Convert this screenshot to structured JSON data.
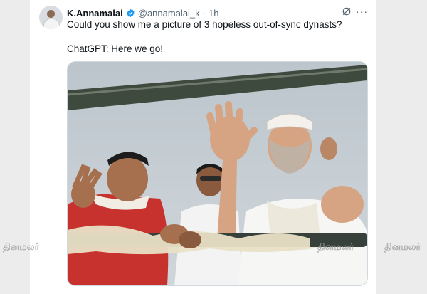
{
  "tweet": {
    "author_name": "K.Annamalai",
    "handle": "@annamalai_k",
    "separator": "·",
    "time": "1h",
    "text_line1": "Could you show me a picture of 3 hopeless out-of-sync dynasts?",
    "text_line2": "ChatGPT: Here we go!",
    "more_label": "···"
  },
  "watermark": {
    "text": "தினமலர்"
  },
  "colors": {
    "verified": "#1d9bf0",
    "secondary_text": "#536471"
  },
  "icons": [
    "verified-badge-icon",
    "grok-icon",
    "more-options-icon"
  ]
}
